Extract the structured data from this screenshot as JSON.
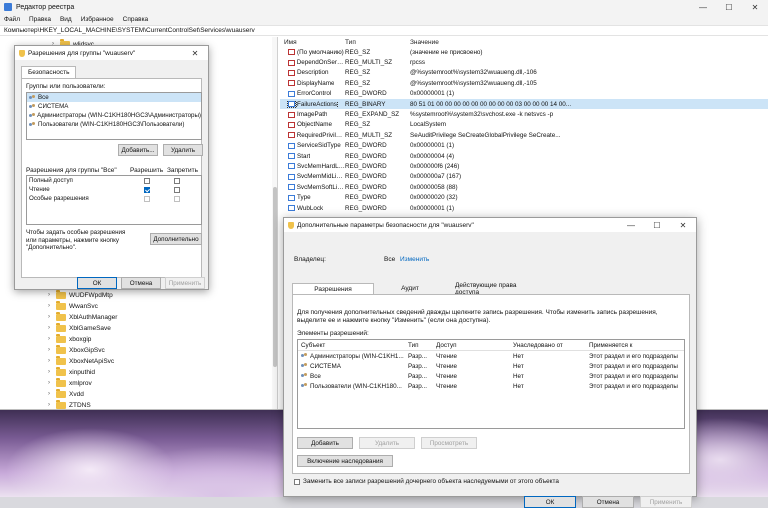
{
  "regedit": {
    "title": "Редактор реестра",
    "menu": [
      "Файл",
      "Правка",
      "Вид",
      "Избранное",
      "Справка"
    ],
    "address": "Компьютер\\HKEY_LOCAL_MACHINE\\SYSTEM\\CurrentControlSet\\Services\\wuauserv",
    "tree_top_item": "wlidsvc",
    "tree_items": [
      "WUDFWpdMtp",
      "WwanSvc",
      "XblAuthManager",
      "XblGameSave",
      "xboxgip",
      "XboxGipSvc",
      "XboxNetApiSvc",
      "xinputhid",
      "xmlprov",
      "Xvdd",
      "ZTDNS"
    ],
    "columns": {
      "name": "Имя",
      "type": "Тип",
      "data": "Значение"
    },
    "values": [
      {
        "name": "(По умолчанию)",
        "type": "REG_SZ",
        "data": "(значение не присвоено)",
        "icon": "string"
      },
      {
        "name": "DependOnService",
        "type": "REG_MULTI_SZ",
        "data": "rpcss",
        "icon": "string"
      },
      {
        "name": "Description",
        "type": "REG_SZ",
        "data": "@%systemroot%\\system32\\wuaueng.dll,-106",
        "icon": "string"
      },
      {
        "name": "DisplayName",
        "type": "REG_SZ",
        "data": "@%systemroot%\\system32\\wuaueng.dll,-105",
        "icon": "string"
      },
      {
        "name": "ErrorControl",
        "type": "REG_DWORD",
        "data": "0x00000001 (1)",
        "icon": "binary"
      },
      {
        "name": "FailureActions",
        "type": "REG_BINARY",
        "data": "80 51 01 00 00 00 00 00 00 00 00 00 03 00 00 00 14 00...",
        "icon": "binary"
      },
      {
        "name": "ImagePath",
        "type": "REG_EXPAND_SZ",
        "data": "%systemroot%\\system32\\svchost.exe -k netsvcs -p",
        "icon": "string"
      },
      {
        "name": "ObjectName",
        "type": "REG_SZ",
        "data": "LocalSystem",
        "icon": "string"
      },
      {
        "name": "RequiredPrivileg...",
        "type": "REG_MULTI_SZ",
        "data": "SeAuditPrivilege SeCreateGlobalPrivilege SeCreate...",
        "icon": "string"
      },
      {
        "name": "ServiceSidType",
        "type": "REG_DWORD",
        "data": "0x00000001 (1)",
        "icon": "binary"
      },
      {
        "name": "Start",
        "type": "REG_DWORD",
        "data": "0x00000004 (4)",
        "icon": "binary"
      },
      {
        "name": "SvcMemHardLi...",
        "type": "REG_DWORD",
        "data": "0x000000f6 (246)",
        "icon": "binary"
      },
      {
        "name": "SvcMemMidLim...",
        "type": "REG_DWORD",
        "data": "0x000000a7 (167)",
        "icon": "binary"
      },
      {
        "name": "SvcMemSoftLim...",
        "type": "REG_DWORD",
        "data": "0x00000058 (88)",
        "icon": "binary"
      },
      {
        "name": "Type",
        "type": "REG_DWORD",
        "data": "0x00000020 (32)",
        "icon": "binary"
      },
      {
        "name": "WubLock",
        "type": "REG_DWORD",
        "data": "0x00000001 (1)",
        "icon": "binary"
      }
    ]
  },
  "perm": {
    "title": "Разрешения для группы \"wuauserv\"",
    "tab": "Безопасность",
    "groups_label": "Группы или пользователи:",
    "groups": [
      "Все",
      "СИСТЕМА",
      "Администраторы (WIN-C1KH180HGC3\\Администраторы)",
      "Пользователи (WIN-C1KH180HGC3\\Пользователи)"
    ],
    "add_button": "Добавить...",
    "remove_button": "Удалить",
    "perms_label": "Разрешения для группы \"Все\"",
    "allow_label": "Разрешить",
    "deny_label": "Запретить",
    "perms": [
      {
        "name": "Полный доступ",
        "allow": false,
        "deny": false
      },
      {
        "name": "Чтение",
        "allow": true,
        "deny": false
      },
      {
        "name": "Особые разрешения",
        "allow": false,
        "deny": false
      }
    ],
    "special_text": "Чтобы задать особые разрешения или параметры, нажмите кнопку \"Дополнительно\".",
    "advanced_button": "Дополнительно",
    "ok": "ОК",
    "cancel": "Отмена",
    "apply": "Применить"
  },
  "adv": {
    "title": "Дополнительные параметры безопасности для \"wuauserv\"",
    "owner_label": "Владелец:",
    "owner_value": "Все",
    "owner_change": "Изменить",
    "tabs": [
      "Разрешения",
      "Аудит",
      "Действующие права доступа"
    ],
    "info_text": "Для получения дополнительных сведений дважды щелкните запись разрешения. Чтобы изменить запись разрешения, выделите ее и нажмите кнопку \"Изменить\" (если она доступна).",
    "entries_label": "Элементы разрешений:",
    "columns": {
      "subject": "Субъект",
      "type": "Тип",
      "access": "Доступ",
      "inherited": "Унаследовано от",
      "applies": "Применяется к"
    },
    "entries": [
      {
        "subject": "Администраторы (WIN-C1KH1...",
        "type": "Разр...",
        "access": "Чтение",
        "inherited": "Нет",
        "applies": "Этот раздел и его подразделы"
      },
      {
        "subject": "СИСТЕМА",
        "type": "Разр...",
        "access": "Чтение",
        "inherited": "Нет",
        "applies": "Этот раздел и его подразделы"
      },
      {
        "subject": "Все",
        "type": "Разр...",
        "access": "Чтение",
        "inherited": "Нет",
        "applies": "Этот раздел и его подразделы"
      },
      {
        "subject": "Пользователи (WIN-C1KH180...",
        "type": "Разр...",
        "access": "Чтение",
        "inherited": "Нет",
        "applies": "Этот раздел и его подразделы"
      }
    ],
    "add_button": "Добавить",
    "remove_button": "Удалить",
    "view_button": "Просмотреть",
    "inherit_button": "Включение наследования",
    "replace_label": "Заменить все записи разрешений дочернего объекта наследуемыми от этого объекта",
    "ok": "ОК",
    "cancel": "Отмена",
    "apply": "Применить"
  }
}
